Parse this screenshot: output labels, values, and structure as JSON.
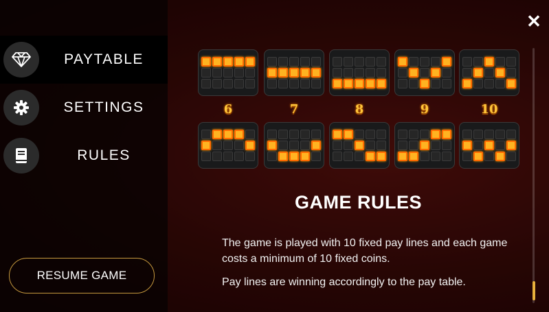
{
  "menu": {
    "items": [
      {
        "label": "PAYTABLE",
        "icon": "diamond-icon",
        "active": true
      },
      {
        "label": "SETTINGS",
        "icon": "gear-icon",
        "active": false
      },
      {
        "label": "RULES",
        "icon": "book-icon",
        "active": false
      }
    ],
    "resume_label": "RESUME GAME"
  },
  "close_label": "✕",
  "paylines": [
    {
      "number": "",
      "cells": [
        [
          1,
          1,
          1,
          1,
          1
        ],
        [
          0,
          0,
          0,
          0,
          0
        ],
        [
          0,
          0,
          0,
          0,
          0
        ]
      ]
    },
    {
      "number": "",
      "cells": [
        [
          0,
          0,
          0,
          0,
          0
        ],
        [
          1,
          1,
          1,
          1,
          1
        ],
        [
          0,
          0,
          0,
          0,
          0
        ]
      ]
    },
    {
      "number": "",
      "cells": [
        [
          0,
          0,
          0,
          0,
          0
        ],
        [
          0,
          0,
          0,
          0,
          0
        ],
        [
          1,
          1,
          1,
          1,
          1
        ]
      ]
    },
    {
      "number": "",
      "cells": [
        [
          1,
          0,
          0,
          0,
          1
        ],
        [
          0,
          1,
          0,
          1,
          0
        ],
        [
          0,
          0,
          1,
          0,
          0
        ]
      ]
    },
    {
      "number": "",
      "cells": [
        [
          0,
          0,
          1,
          0,
          0
        ],
        [
          0,
          1,
          0,
          1,
          0
        ],
        [
          1,
          0,
          0,
          0,
          1
        ]
      ]
    },
    {
      "number": "6",
      "cells": [
        [
          0,
          1,
          1,
          1,
          0
        ],
        [
          1,
          0,
          0,
          0,
          1
        ],
        [
          0,
          0,
          0,
          0,
          0
        ]
      ]
    },
    {
      "number": "7",
      "cells": [
        [
          0,
          0,
          0,
          0,
          0
        ],
        [
          1,
          0,
          0,
          0,
          1
        ],
        [
          0,
          1,
          1,
          1,
          0
        ]
      ]
    },
    {
      "number": "8",
      "cells": [
        [
          1,
          1,
          0,
          0,
          0
        ],
        [
          0,
          0,
          1,
          0,
          0
        ],
        [
          0,
          0,
          0,
          1,
          1
        ]
      ]
    },
    {
      "number": "9",
      "cells": [
        [
          0,
          0,
          0,
          1,
          1
        ],
        [
          0,
          0,
          1,
          0,
          0
        ],
        [
          1,
          1,
          0,
          0,
          0
        ]
      ]
    },
    {
      "number": "10",
      "cells": [
        [
          0,
          0,
          0,
          0,
          0
        ],
        [
          1,
          0,
          1,
          0,
          1
        ],
        [
          0,
          1,
          0,
          1,
          0
        ]
      ]
    }
  ],
  "rules": {
    "title": "GAME RULES",
    "paragraphs": [
      "The game is played with 10 fixed pay lines and each game costs a minimum of 10 fixed coins.",
      "Pay lines are winning accordingly to the pay table."
    ]
  },
  "colors": {
    "accent": "#ffb321",
    "border_gold": "#c79a3e",
    "number_gold": "#ffc53a"
  },
  "scroll_position": 0.92
}
